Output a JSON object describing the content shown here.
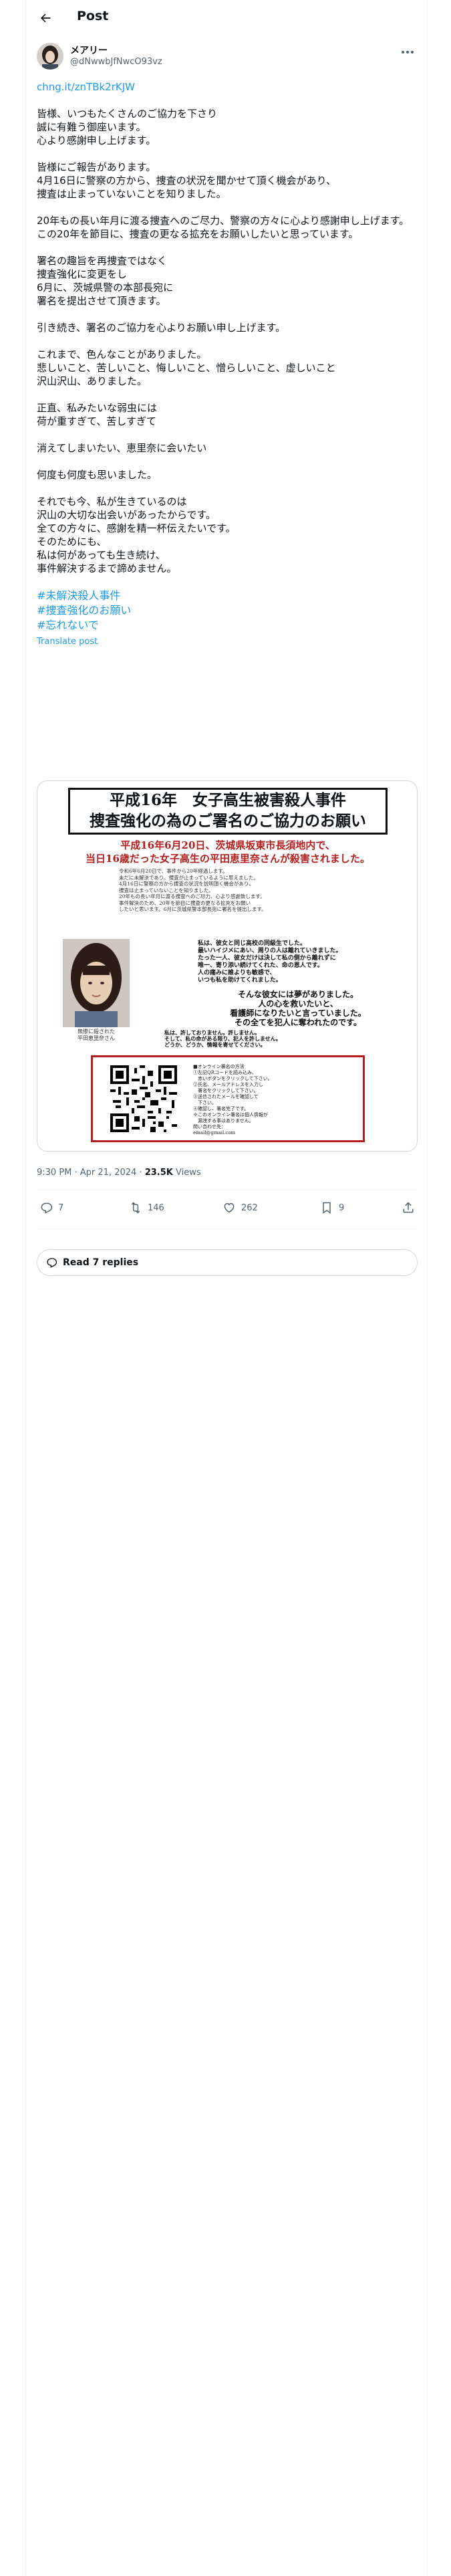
{
  "header": {
    "title": "Post"
  },
  "author": {
    "name": "メアリー",
    "handle": "@dNwwbJfNwcO93vz"
  },
  "post": {
    "link": "chng.it/znTBk2rKJW",
    "paragraphs": [
      "皆様、いつもたくさんのご協力を下さり\n誠に有難う御座います。\n心より感謝申し上げます。",
      "皆様にご報告があります。\n4月16日に警察の方から、捜査の状況を聞かせて頂く機会があり、\n捜査は止まっていないことを知りました。",
      "20年もの長い年月に渡る捜査へのご尽力、警察の方々に心より感謝申し上げます。\nこの20年を節目に、捜査の更なる拡充をお願いしたいと思っています。",
      "署名の趣旨を再捜査ではなく\n捜査強化に変更をし\n6月に、茨城県警の本部長宛に\n署名を提出させて頂きます。",
      "引き続き、署名のご協力を心よりお願い申し上げます。",
      "これまで、色んなことがありました。\n悲しいこと、苦しいこと、悔しいこと、憎らしいこと、虚しいこと\n沢山沢山、ありました。",
      "正直、私みたいな弱虫には\n荷が重すぎて、苦しすぎて",
      "消えてしまいたい、恵里奈に会いたい",
      "何度も何度も思いました。",
      "それでも今、私が生きているのは\n沢山の大切な出会いがあったからです。\n全ての方々に、感謝を精一杯伝えたいです。\nそのためにも、\n私は何があっても生き続け、\n事件解決するまで諦めません。"
    ],
    "hashtags": [
      "#未解決殺人事件",
      "#捜査強化のお願い",
      "#忘れないで"
    ],
    "translate": "Translate post"
  },
  "poster": {
    "title_line1": "平成16年　女子高生被害殺人事件",
    "title_line2": "捜査強化の為のご署名のご協力のお願い",
    "red_line1": "平成16年6月20日、茨城県坂東市長須地内で、",
    "red_line2": "当日16歳だった女子高生の平田恵里奈さんが殺害されました。",
    "intro": [
      "令和6年6月20日で、事件から20年経過します。",
      "未だに未解決であり、捜査が止まっているように思えました。",
      "4月16日に警察の方から捜査の状況を説明頂く機会があり、",
      "捜査は止まっていないことを知りました。",
      "20年もの長い年月に渡る捜査へのご尽力、心より感謝致します。",
      "事件解決のため、20年を節目に捜査の更なる拡充をお願い",
      "したいと思います。6月に茨城県警本部長宛に署名を提出します。"
    ],
    "photo_caption": [
      "無惨に殺された",
      "平田恵里奈さん"
    ],
    "middle": [
      "私は、彼女と同じ高校の同級生でした。",
      "最いハイジメにあい、周りの人は離れていきました。",
      "たった一人、彼女だけは決して私の側から離れずに",
      "唯一、寄り添い続けてくれた、命の恩人です。",
      "人の痛みに誰よりも敏感で、",
      "いつも私を助けてくれました。"
    ],
    "big": [
      "そんな彼女には夢がありました。",
      "人の心を救いたいと、",
      "看護師になりたいと言っていました。",
      "その全てを犯人に奪われたのです。"
    ],
    "lower": [
      "私は、許しておりません。許しません。",
      "そして、私の命がある限り、犯人を許しません。",
      "どうか、どうか、情報を寄せてください。",
      "犯人が捕まるその日まで、諦めません。",
      "そして、どうかご協力をお願いいたします。"
    ],
    "box_lines": [
      "■オンライン署名の方法",
      "①左記QRコードを読み込み、",
      "　赤いボタンをクリックして下さい。",
      "②氏名、メールアドレスを入力し",
      "　署名をクリックして下さい。",
      "③送信されたメールを確認して",
      "　下さい。",
      "④確認し、署名完了です。",
      "※このオンライン署名は個人情報が",
      "　漏洩する事はありません。",
      "",
      "問い合わせ先：",
      "email@gmail.com"
    ]
  },
  "meta": {
    "time": "9:30 PM · Apr 21, 2024 · ",
    "views_count": "23.5K",
    "views_label": " Views"
  },
  "actions": {
    "replies": "7",
    "reposts": "146",
    "likes": "262",
    "bookmarks": "9"
  },
  "read_replies": "Read 7 replies"
}
